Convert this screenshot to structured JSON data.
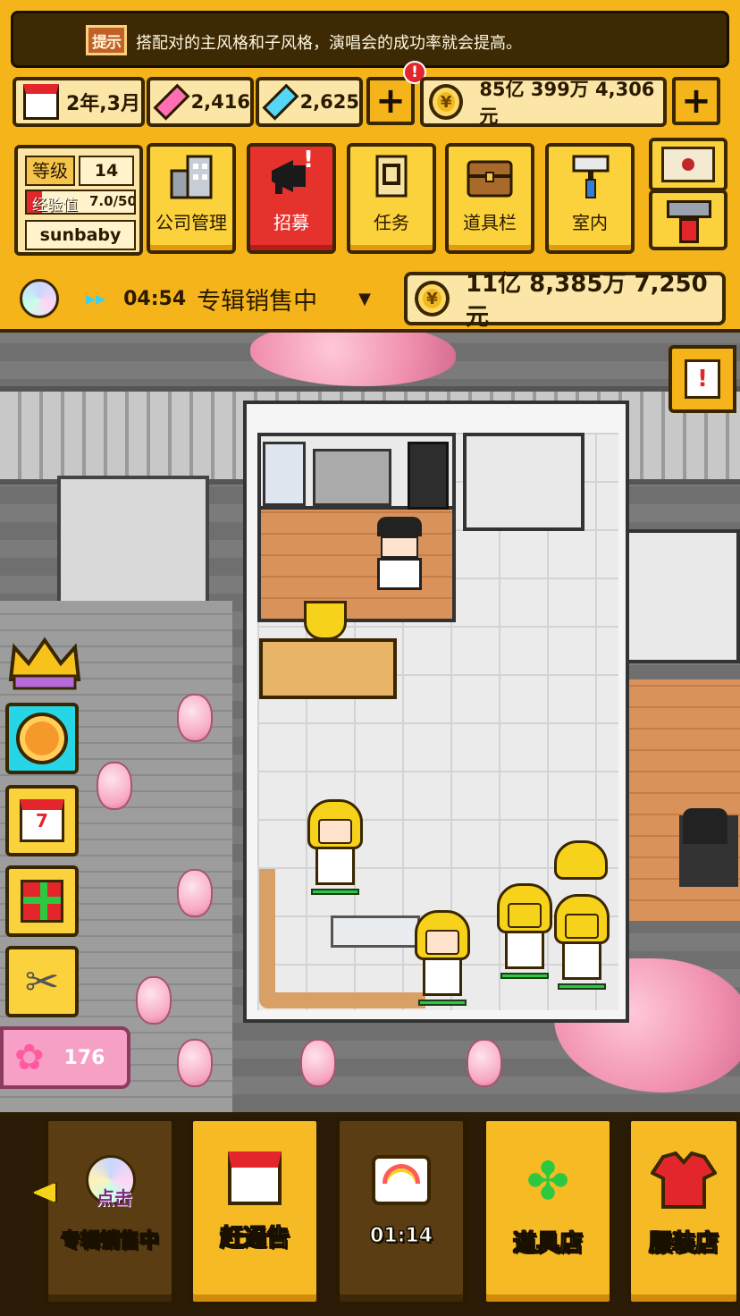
{
  "tip": {
    "badge": "提示",
    "text": "搭配对的主风格和子风格，演唱会的成功率就会提高。"
  },
  "resources": {
    "date": "2年,3月",
    "pink_gems": "2,416",
    "blue_gems": "2,625",
    "gold": "85亿 399万 4,306元",
    "plus_alert": "!"
  },
  "player": {
    "level_label": "等级",
    "level": "14",
    "exp_label": "经验值",
    "exp": "7.0/50",
    "name": "sunbaby"
  },
  "menu": [
    {
      "label": "公司管理",
      "icon": "building-icon"
    },
    {
      "label": "招募",
      "icon": "megaphone-icon",
      "alert": "!"
    },
    {
      "label": "任务",
      "icon": "scroll-icon"
    },
    {
      "label": "道具栏",
      "icon": "chest-icon"
    },
    {
      "label": "室内",
      "icon": "paint-roller-icon"
    }
  ],
  "status": {
    "timer": "04:54",
    "activity": "专辑销售中",
    "album_money": "11亿 8,385万 7,250元"
  },
  "scene": {
    "flower_count": "176",
    "side_buttons": [
      "crown-icon",
      "pizza-icon",
      "calendar-icon",
      "gift-icon",
      "scissors-icon"
    ]
  },
  "bottom_nav": [
    {
      "label": "专辑销售中",
      "badge": "点击",
      "icon": "cd-icon"
    },
    {
      "label": "赶通告",
      "icon": "calendar-icon"
    },
    {
      "label": "01:14",
      "icon": "rainbow-tv-icon"
    },
    {
      "label": "道具店",
      "icon": "clover-icon"
    },
    {
      "label": "服装店",
      "icon": "shirt-icon"
    }
  ],
  "colors": {
    "hud_bg": "#f4b41a",
    "panel": "#fbe6a8",
    "outline": "#3a2600",
    "alert": "#e3262b",
    "recruit": "#e5322c",
    "blossom": "#f08fae"
  }
}
